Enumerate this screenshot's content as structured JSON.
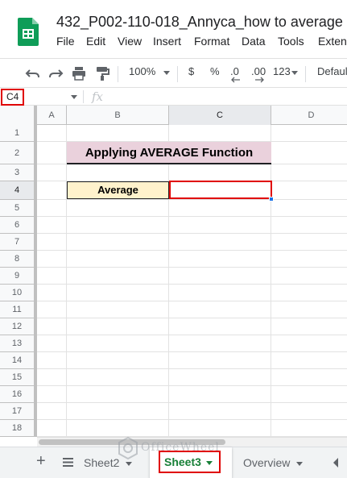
{
  "document": {
    "title": "432_P002-110-018_Annyca_how to average ..."
  },
  "menu": {
    "items": [
      "File",
      "Edit",
      "View",
      "Insert",
      "Format",
      "Data",
      "Tools",
      "Exten"
    ]
  },
  "toolbar": {
    "zoom": "100%",
    "currency": "$",
    "percent": "%",
    "decrease_decimal": ".0",
    "increase_decimal": ".00",
    "number_format": "123",
    "font": "Defaul"
  },
  "formula_bar": {
    "cell_reference": "C4",
    "fx_label": "fx",
    "formula": ""
  },
  "grid": {
    "columns": [
      "A",
      "B",
      "C",
      "D"
    ],
    "active_column": "C",
    "rows": [
      "1",
      "2",
      "3",
      "4",
      "5",
      "6",
      "7",
      "8",
      "9",
      "10",
      "11",
      "12",
      "13",
      "14",
      "15",
      "16",
      "17",
      "18"
    ],
    "active_row": "4",
    "cells": {
      "B2": "Applying AVERAGE Function",
      "B4": "Average",
      "C4": ""
    }
  },
  "sheet_tabs": {
    "tabs": [
      "Sheet2",
      "Sheet3",
      "Overview"
    ],
    "active": "Sheet3"
  },
  "watermark": {
    "text": "OfficeWheel"
  },
  "colors": {
    "title_fill": "#ead1dc",
    "label_fill": "#fff2cc",
    "highlight_border": "#e00000",
    "active_tab_text": "#188038",
    "logo_green": "#0f9d58"
  }
}
